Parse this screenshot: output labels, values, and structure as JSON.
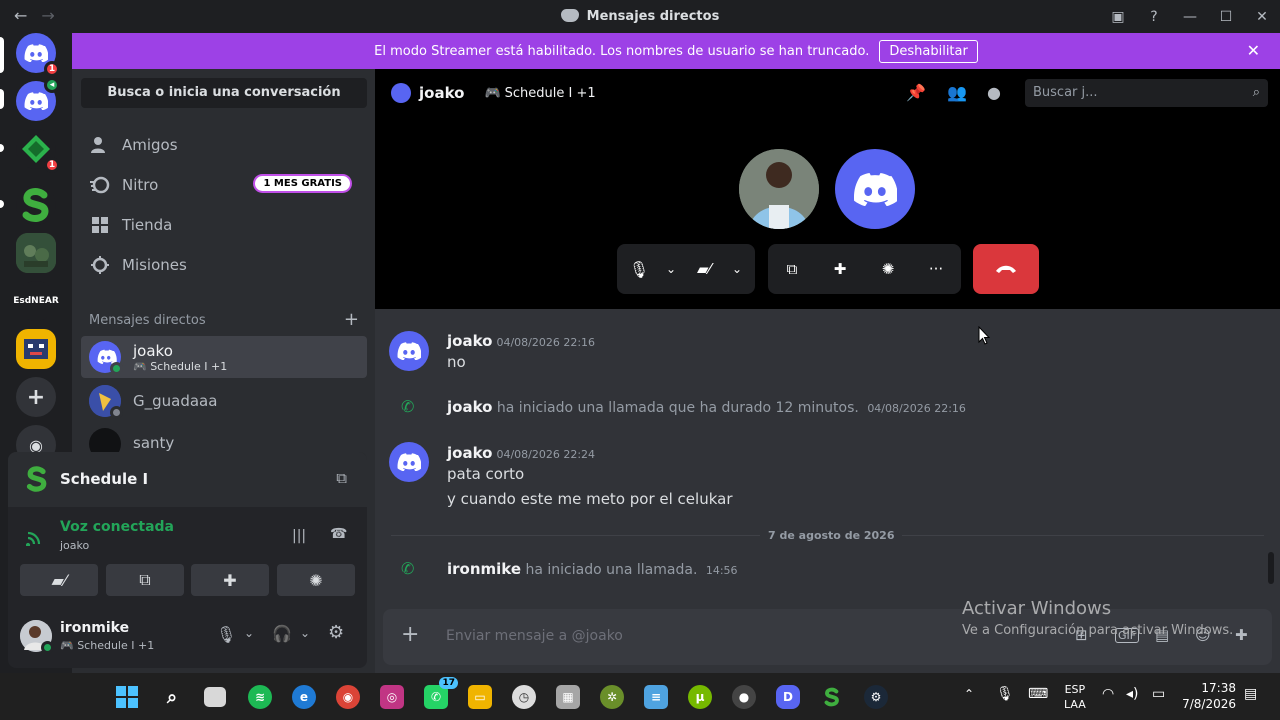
{
  "window": {
    "title": "Mensajes directos",
    "back_icon": "arrow-left-icon",
    "forward_icon": "arrow-right-icon"
  },
  "banner": {
    "text": "El modo Streamer está habilitado. Los nombres de usuario se han truncado.",
    "button": "Deshabilitar",
    "color": "#9d41e6"
  },
  "rail": {
    "servers": [
      {
        "name": "discord-home",
        "badge": "1"
      },
      {
        "name": "discord-voice"
      },
      {
        "name": "green-diamond",
        "badge": "1"
      },
      {
        "name": "schedule-server"
      },
      {
        "name": "game-server"
      },
      {
        "label": "EsdNEAR"
      },
      {
        "name": "yellow-server"
      }
    ]
  },
  "dm": {
    "search_label": "Busca o inicia una conversación",
    "nav": [
      {
        "label": "Amigos",
        "icon": "friends-icon"
      },
      {
        "label": "Nitro",
        "icon": "nitro-icon",
        "badge": "1 MES GRATIS"
      },
      {
        "label": "Tienda",
        "icon": "shop-icon"
      },
      {
        "label": "Misiones",
        "icon": "quests-icon"
      }
    ],
    "header": "Mensajes directos",
    "items": [
      {
        "name": "joako",
        "sub": "Schedule I +1"
      },
      {
        "name": "G_guadaaa"
      },
      {
        "name": "santy"
      }
    ]
  },
  "voice": {
    "activity": "Schedule I",
    "status": "Voz conectada",
    "channel": "joako"
  },
  "user": {
    "name": "ironmike",
    "sub": "Schedule I +1"
  },
  "chat": {
    "header_name": "joako",
    "header_activity": "Schedule I +1",
    "search_placeholder": "Buscar j...",
    "messages": [
      {
        "author": "joako",
        "time": "04/08/2026 22:16",
        "lines": [
          "no"
        ]
      },
      {
        "system_author": "joako",
        "system_text": "ha iniciado una llamada que ha durado 12 minutos.",
        "time": "04/08/2026 22:16"
      },
      {
        "author": "joako",
        "time": "04/08/2026 22:24",
        "lines": [
          "pata corto",
          "y cuando este me meto por el celukar"
        ]
      },
      {
        "system_author": "ironmike",
        "system_text": "ha iniciado una llamada.",
        "time": "14:56"
      }
    ],
    "date_divider": "7 de agosto de 2026",
    "composer_placeholder": "Enviar mensaje a @joako"
  },
  "watermark": {
    "title": "Activar Windows",
    "sub": "Ve a Configuración para activar Windows."
  },
  "taskbar": {
    "lang1": "ESP",
    "lang2": "LAA",
    "time": "17:38",
    "date": "7/8/2026",
    "whatsapp_badge": "17"
  },
  "colors": {
    "blurple": "#5865f2",
    "green": "#23a559",
    "red": "#da373c"
  }
}
